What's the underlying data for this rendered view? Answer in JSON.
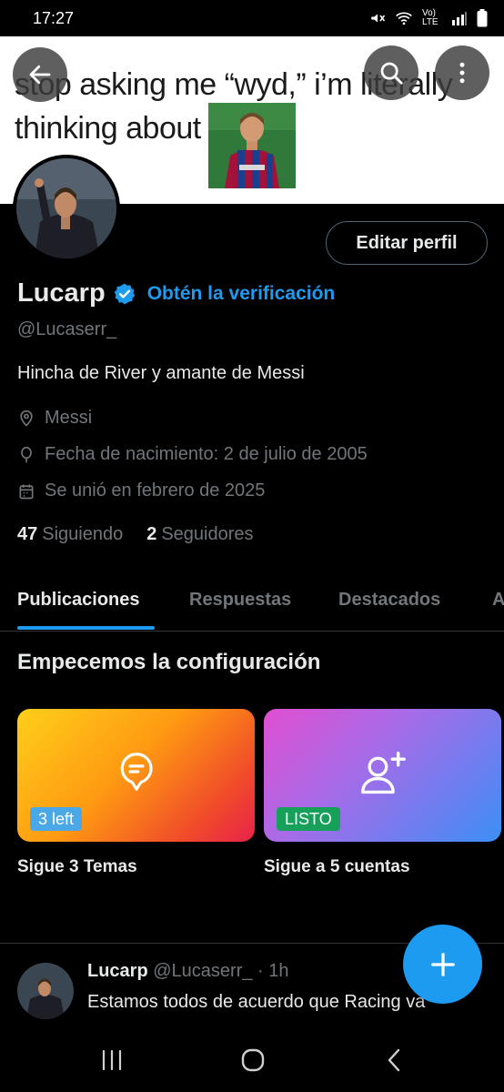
{
  "status_bar": {
    "time": "17:27",
    "network": "Vo) LTE",
    "icons": [
      "mute-icon",
      "wifi-icon",
      "signal-icon",
      "battery-icon"
    ]
  },
  "banner": {
    "meme_line1": "stop asking me “wyd,” i’m literally",
    "meme_line2": "thinking about"
  },
  "profile": {
    "edit_button": "Editar perfil",
    "display_name": "Lucarp",
    "verify_link": "Obtén la verificación",
    "handle": "@Lucaserr_",
    "bio": "Hincha de River y amante de Messi",
    "location": "Messi",
    "birthdate": "Fecha de nacimiento: 2 de julio de 2005",
    "joined": "Se unió en febrero de 2025",
    "following_count": "47",
    "following_label": "Siguiendo",
    "followers_count": "2",
    "followers_label": "Seguidores"
  },
  "tabs": [
    {
      "label": "Publicaciones",
      "active": true
    },
    {
      "label": "Respuestas",
      "active": false
    },
    {
      "label": "Destacados",
      "active": false
    },
    {
      "label": "A",
      "active": false
    }
  ],
  "setup": {
    "title": "Empecemos la configuración",
    "cards": [
      {
        "badge": "3 left",
        "caption": "Sigue 3 Temas",
        "icon": "topic-bubble-icon"
      },
      {
        "badge": "LISTO",
        "caption": "Sigue a 5 cuentas",
        "icon": "add-person-icon"
      }
    ]
  },
  "post": {
    "author": "Lucarp",
    "handle_time": "@Lucaserr_ · 1h",
    "text": "Estamos todos de acuerdo que Racing va"
  },
  "colors": {
    "accent": "#1d9bf0",
    "background": "#000000",
    "secondary_text": "#71767b",
    "done_badge": "#16a05a",
    "left_badge": "#4aa8e8"
  }
}
